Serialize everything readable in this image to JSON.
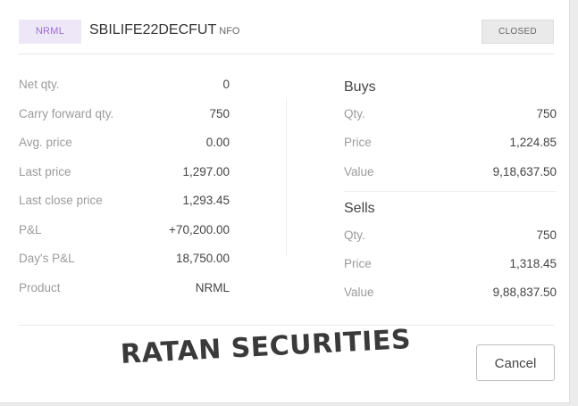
{
  "header": {
    "product": "NRML",
    "symbol": "SBILIFE22DECFUT",
    "exchange": "NFO",
    "status": "CLOSED"
  },
  "position": [
    {
      "label": "Net qty.",
      "value": "0"
    },
    {
      "label": "Carry forward qty.",
      "value": "750"
    },
    {
      "label": "Avg. price",
      "value": "0.00"
    },
    {
      "label": "Last price",
      "value": "1,297.00"
    },
    {
      "label": "Last close price",
      "value": "1,293.45"
    },
    {
      "label": "P&L",
      "value": "+70,200.00"
    },
    {
      "label": "Day's P&L",
      "value": "18,750.00"
    },
    {
      "label": "Product",
      "value": "NRML"
    }
  ],
  "buys": {
    "title": "Buys",
    "rows": [
      {
        "label": "Qty.",
        "value": "750"
      },
      {
        "label": "Price",
        "value": "1,224.85"
      },
      {
        "label": "Value",
        "value": "9,18,637.50"
      }
    ]
  },
  "sells": {
    "title": "Sells",
    "rows": [
      {
        "label": "Qty.",
        "value": "750"
      },
      {
        "label": "Price",
        "value": "1,318.45"
      },
      {
        "label": "Value",
        "value": "9,88,837.50"
      }
    ]
  },
  "watermark": "RATAN SECURITIES",
  "footer": {
    "cancel_label": "Cancel"
  },
  "colors": {
    "product_tag_bg": "#eee7f8",
    "product_tag_text": "#9b6fd0",
    "label": "#9b9b9b",
    "value": "#444444"
  }
}
